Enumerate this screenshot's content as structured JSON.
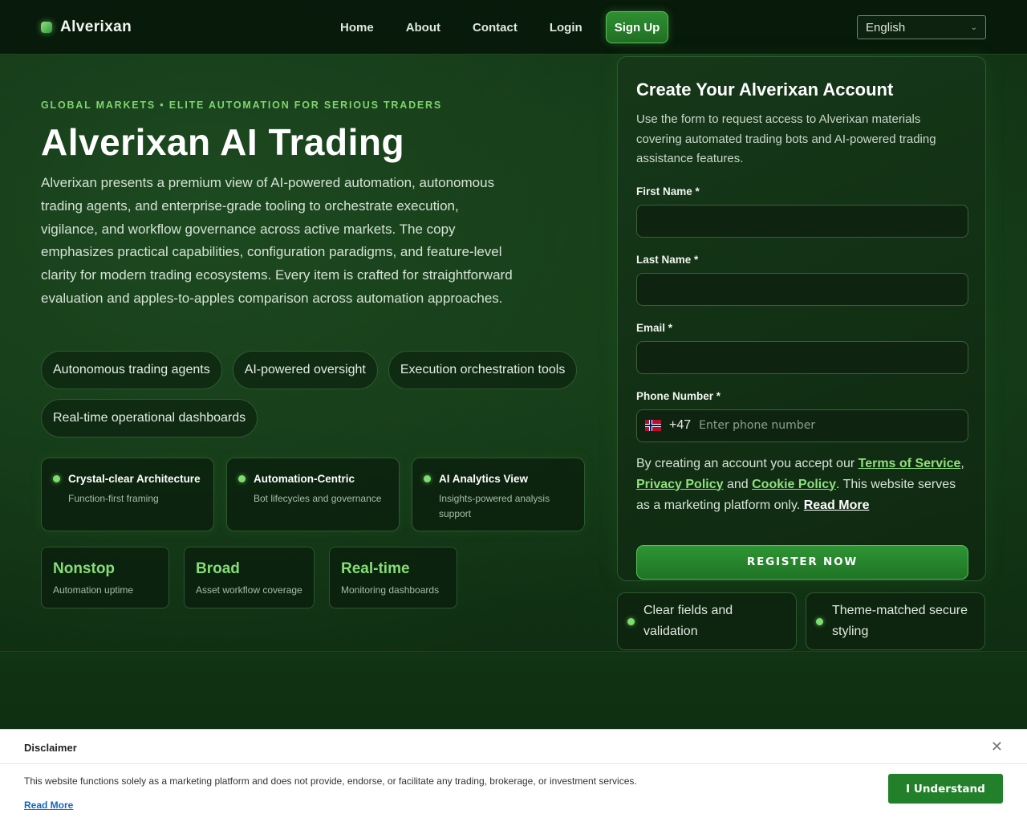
{
  "nav": {
    "brand": "Alverixan",
    "links": [
      "Home",
      "About",
      "Contact",
      "Login"
    ],
    "signup": "Sign Up",
    "language": "English"
  },
  "hero": {
    "eyebrow": "GLOBAL MARKETS • ELITE AUTOMATION FOR SERIOUS TRADERS",
    "title": "Alverixan AI Trading",
    "description": "Alverixan presents a premium view of AI-powered automation, autonomous trading agents, and enterprise-grade tooling to orchestrate execution, vigilance, and workflow governance across active markets. The copy emphasizes practical capabilities, configuration paradigms, and feature-level clarity for modern trading ecosystems. Every item is crafted for straightforward evaluation and apples-to-apples comparison across automation approaches.",
    "chips": [
      "Autonomous trading agents",
      "AI-powered oversight",
      "Execution orchestration tools",
      "Real-time operational dashboards"
    ],
    "features": [
      {
        "title": "Crystal-clear Architecture",
        "sub": "Function-first framing"
      },
      {
        "title": "Automation-Centric",
        "sub": "Bot lifecycles and governance"
      },
      {
        "title": "AI Analytics View",
        "sub": "Insights-powered analysis support"
      }
    ],
    "stats": [
      {
        "value": "Nonstop",
        "label": "Automation uptime"
      },
      {
        "value": "Broad",
        "label": "Asset workflow coverage"
      },
      {
        "value": "Real-time",
        "label": "Monitoring dashboards"
      }
    ]
  },
  "form": {
    "title": "Create Your Alverixan Account",
    "description": "Use the form to request access to Alverixan materials covering automated trading bots and AI-powered trading assistance features.",
    "first_name_label": "First Name *",
    "last_name_label": "Last Name *",
    "email_label": "Email *",
    "phone_label": "Phone Number *",
    "dial_code": "+47",
    "phone_placeholder": "Enter phone number",
    "consent_prefix": "By creating an account you accept our ",
    "terms": "Terms of Service",
    "sep1": ", ",
    "privacy": "Privacy Policy",
    "and": " and ",
    "cookie": "Cookie Policy",
    "consent_suffix": ". This website serves as a marketing platform only. ",
    "read_more": "Read More",
    "register": "REGISTER NOW"
  },
  "mini_cards": [
    "Clear fields and validation",
    "Theme-matched secure styling"
  ],
  "disclaimer": {
    "title": "Disclaimer",
    "text": "This website functions solely as a marketing platform and does not provide, endorse, or facilitate any trading, brokerage, or investment services.",
    "read_more": "Read More",
    "button": "I Understand"
  },
  "colors": {
    "accent": "#7fd46f",
    "button_green": "#22802a",
    "background": "#0c2410"
  }
}
